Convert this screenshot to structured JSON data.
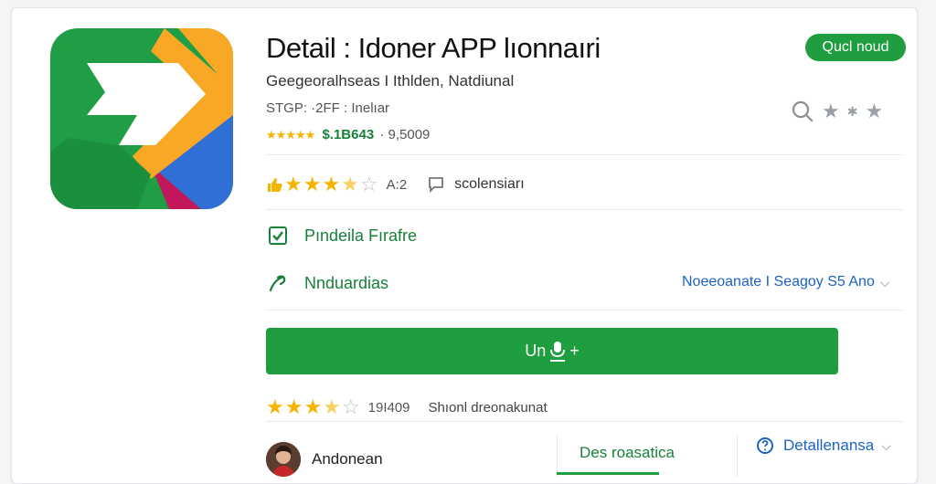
{
  "app": {
    "title": "Detail : Idoner APP lıonnaıri",
    "subtitle": "Geegeoralhseas I Ithlden, Natdiunal",
    "meta": "STGP: ·2FF : Inelıar",
    "small_stars": "★★★★★",
    "price": "$.1B643",
    "downloads": "· 9,5009",
    "status_badge": "Qucl noud"
  },
  "rating": {
    "stars_filled": "★★★",
    "stars_half": "★",
    "stars_empty": "☆",
    "count": "A:2",
    "comments_label": "scolensiarı"
  },
  "features": [
    {
      "label": "Pındeila Fırafre"
    },
    {
      "label": "Nnduardias",
      "link": "Noeeoanate I Seagoy S5 Ano"
    }
  ],
  "install": {
    "label_left": "Un",
    "label_right": "+"
  },
  "reviews": {
    "stars_filled": "★★★",
    "stars_half": "★",
    "stars_empty": "☆",
    "count": "19I409",
    "label": "Shıonl dreonakunat"
  },
  "bottom": {
    "author": "Andonean",
    "description_tab": "Des roasatica",
    "details_tab": "Detallenansa"
  },
  "colors": {
    "accent_green": "#1e9e3e",
    "link_blue": "#1a62c4",
    "star_yellow": "#f4b400"
  }
}
